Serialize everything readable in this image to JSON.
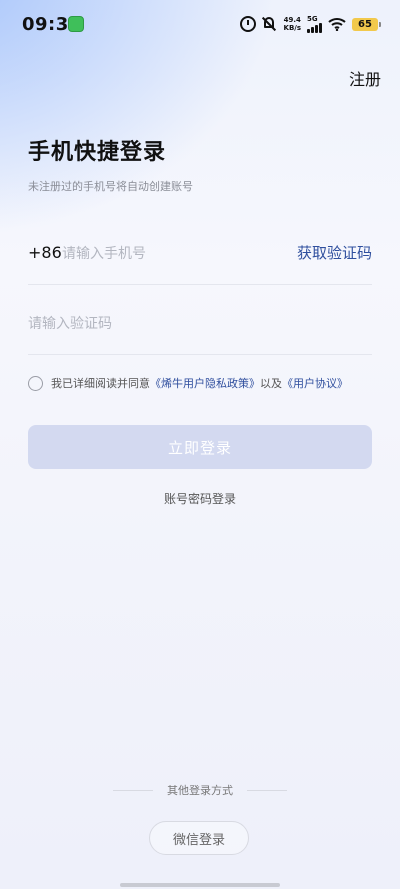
{
  "status_bar": {
    "time": "09:33",
    "net_speed_value": "49.4",
    "net_speed_unit": "KB/s",
    "signal_label": "5G",
    "battery": "65"
  },
  "header": {
    "register_label": "注册"
  },
  "main": {
    "title": "手机快捷登录",
    "subtitle": "未注册过的手机号将自动创建账号",
    "country_code": "+86",
    "phone_placeholder": "请输入手机号",
    "get_code_label": "获取验证码",
    "code_placeholder": "请输入验证码",
    "agreement": {
      "prefix": "我已详细阅读并同意",
      "privacy_link": "《烯牛用户隐私政策》",
      "conjunction": "以及",
      "terms_link": "《用户协议》"
    },
    "login_button_label": "立即登录",
    "password_login_label": "账号密码登录"
  },
  "footer": {
    "other_methods_label": "其他登录方式",
    "wechat_login_label": "微信登录"
  }
}
